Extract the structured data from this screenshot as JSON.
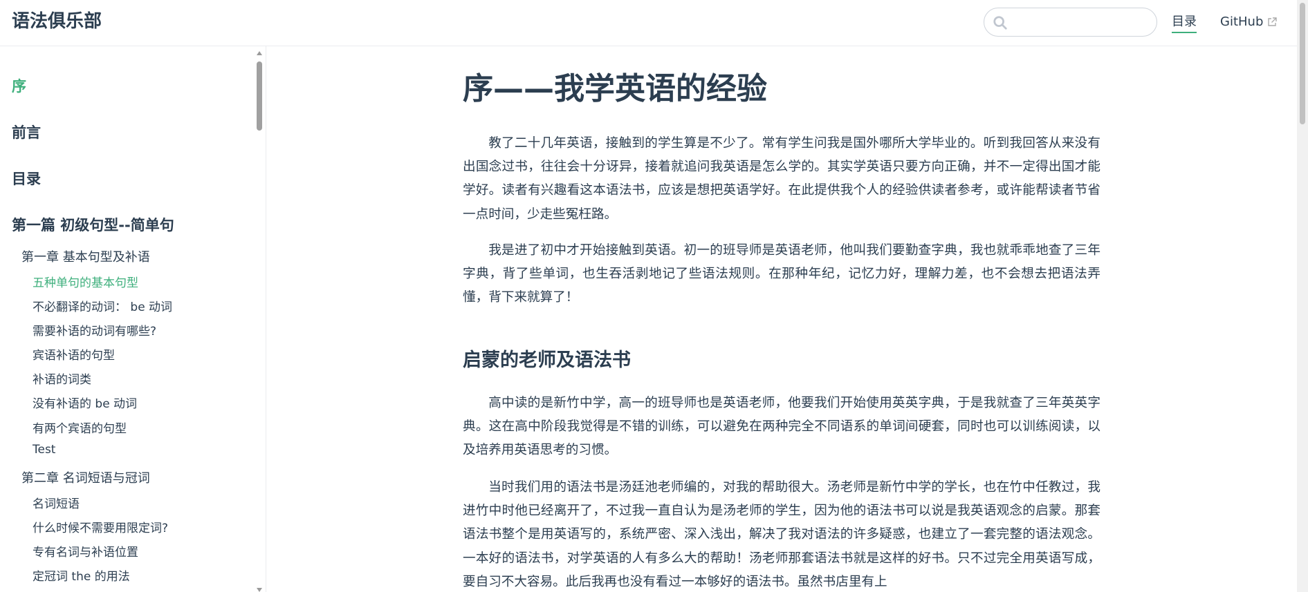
{
  "navbar": {
    "site_name": "语法俱乐部",
    "search_placeholder": "",
    "links": [
      {
        "label": "目录"
      },
      {
        "label": "GitHub"
      }
    ]
  },
  "sidebar": {
    "top_items": [
      "序",
      "前言",
      "目录",
      "第一篇 初级句型--简单句"
    ],
    "chapters": [
      {
        "title": "第一章 基本句型及补语",
        "items": [
          "五种单句的基本句型",
          "不必翻译的动词： be 动词",
          "需要补语的动词有哪些?",
          "宾语补语的句型",
          "补语的词类",
          "没有补语的 be 动词",
          "有两个宾语的句型",
          "Test"
        ]
      },
      {
        "title": "第二章 名词短语与冠词",
        "items": [
          "名词短语",
          "什么时候不需要用限定词?",
          "专有名词与补语位置",
          "定冠词 the 的用法"
        ]
      }
    ]
  },
  "content": {
    "title": "序——我学英语的经验",
    "paragraphs": [
      "教了二十几年英语，接触到的学生算是不少了。常有学生问我是国外哪所大学毕业的。听到我回答从来没有出国念过书，往往会十分讶异，接着就追问我英语是怎么学的。其实学英语只要方向正确，并不一定得出国才能学好。读者有兴趣看这本语法书，应该是想把英语学好。在此提供我个人的经验供读者参考，或许能帮读者节省一点时间，少走些冤枉路。",
      "我是进了初中才开始接触到英语。初一的班导师是英语老师，他叫我们要勤查字典，我也就乖乖地查了三年字典，背了些单词，也生吞活剥地记了些语法规则。在那种年纪，记忆力好，理解力差，也不会想去把语法弄懂，背下来就算了！"
    ],
    "section": {
      "heading": "启蒙的老师及语法书",
      "paragraphs": [
        "高中读的是新竹中学，高一的班导师也是英语老师，他要我们开始使用英英字典，于是我就查了三年英英字典。这在高中阶段我觉得是不错的训练，可以避免在两种完全不同语系的单词间硬套，同时也可以训练阅读，以及培养用英语思考的习惯。",
        "当时我们用的语法书是汤廷池老师编的，对我的帮助很大。汤老师是新竹中学的学长，也在竹中任教过，我进竹中时他已经离开了，不过我一直自认为是汤老师的学生，因为他的语法书可以说是我英语观念的启蒙。那套语法书整个是用英语写的，系统严密、深入浅出，解决了我对语法的许多疑惑，也建立了一套完整的语法观念。一本好的语法书，对学英语的人有多么大的帮助！汤老师那套语法书就是这样的好书。只不过完全用英语写成，要自习不大容易。此后我再也没有看过一本够好的语法书。虽然书店里有上"
      ]
    }
  }
}
